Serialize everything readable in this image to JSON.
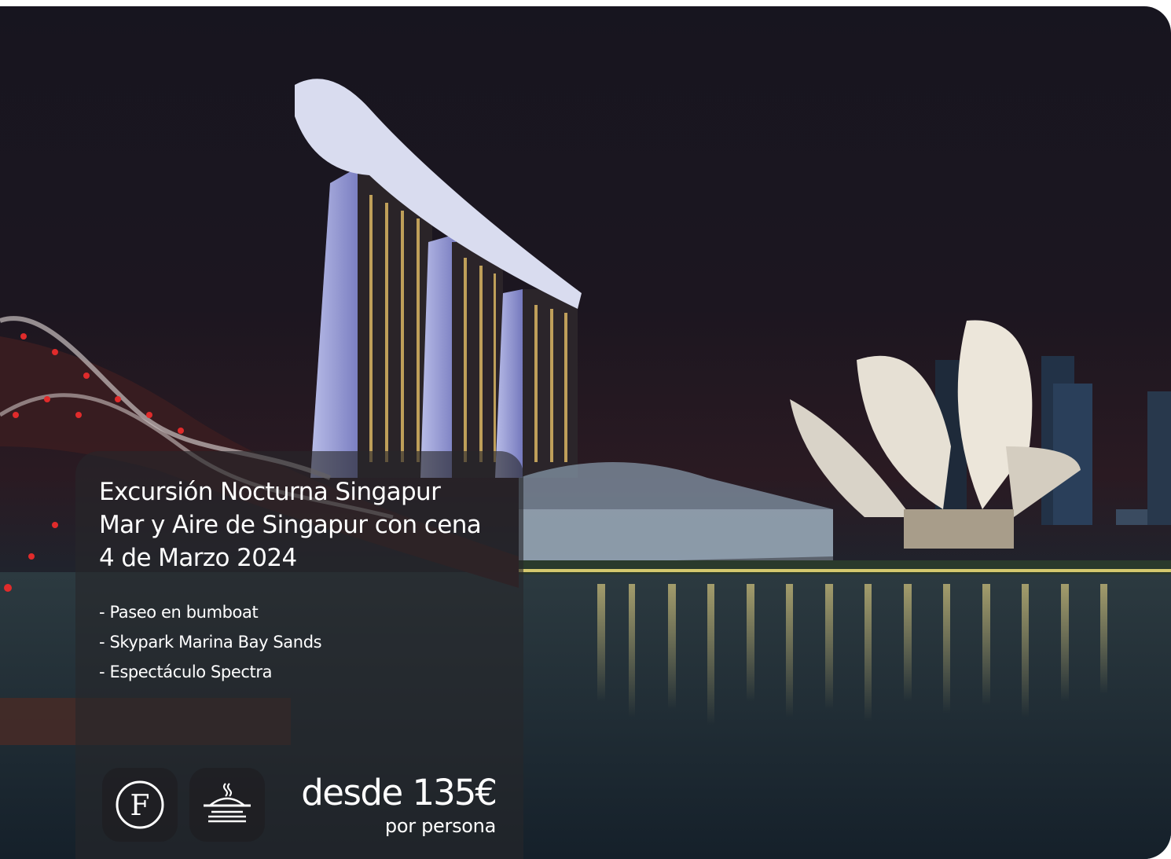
{
  "excursion": {
    "title_line1": "Excursión Nocturna Singapur",
    "title_line2": "Mar y Aire de Singapur con cena",
    "date": "4 de Marzo 2024",
    "highlights": [
      "- Paseo en bumboat",
      "- Skypark Marina Bay Sands",
      "- Espectáculo Spectra"
    ]
  },
  "badges": [
    {
      "icon": "letter-f-icon",
      "letter": "F"
    },
    {
      "icon": "dinner-plate-icon"
    }
  ],
  "price": {
    "prefix": "desde",
    "amount": "135€",
    "unit": "por persona"
  },
  "colors": {
    "sky": "#17151f",
    "water": "#1b2a34",
    "panel": "#26262a",
    "bridge_lights": "#e02b2b",
    "text": "#ffffff"
  }
}
